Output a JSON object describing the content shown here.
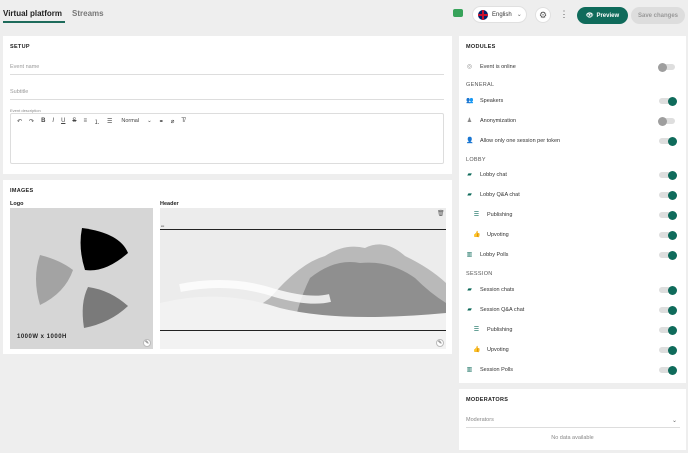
{
  "tabs": {
    "active": "Virtual platform",
    "other": "Streams"
  },
  "header": {
    "language": "English",
    "preview_label": "Preview",
    "save_label": "Save changes"
  },
  "setup": {
    "title": "SETUP",
    "event_name_placeholder": "Event name",
    "subtitle_placeholder": "Subtitle",
    "description_label": "Event description",
    "format_label": "Normal"
  },
  "images": {
    "title": "IMAGES",
    "logo_label": "Logo",
    "header_label": "Header",
    "logo_caption": "1000W x 1000H"
  },
  "modules": {
    "title": "MODULES",
    "groups": {
      "general": "GENERAL",
      "lobby": "LOBBY",
      "session": "SESSION"
    },
    "items": [
      {
        "label": "Event is online",
        "on": false
      },
      {
        "label": "Speakers",
        "on": true
      },
      {
        "label": "Anonymization",
        "on": false
      },
      {
        "label": "Allow only one session per token",
        "on": true
      },
      {
        "label": "Lobby chat",
        "on": true
      },
      {
        "label": "Lobby Q&A chat",
        "on": true
      },
      {
        "label": "Publishing",
        "on": true
      },
      {
        "label": "Upvoting",
        "on": true
      },
      {
        "label": "Lobby Polls",
        "on": true
      },
      {
        "label": "Session chats",
        "on": true
      },
      {
        "label": "Session Q&A chat",
        "on": true
      },
      {
        "label": "Publishing",
        "on": true
      },
      {
        "label": "Upvoting",
        "on": true
      },
      {
        "label": "Session Polls",
        "on": true
      }
    ]
  },
  "moderators": {
    "title": "MODERATORS",
    "placeholder": "Moderators",
    "empty": "No data available"
  },
  "colors": {
    "accent": "#0f6b5b",
    "background": "#eeeeee"
  }
}
